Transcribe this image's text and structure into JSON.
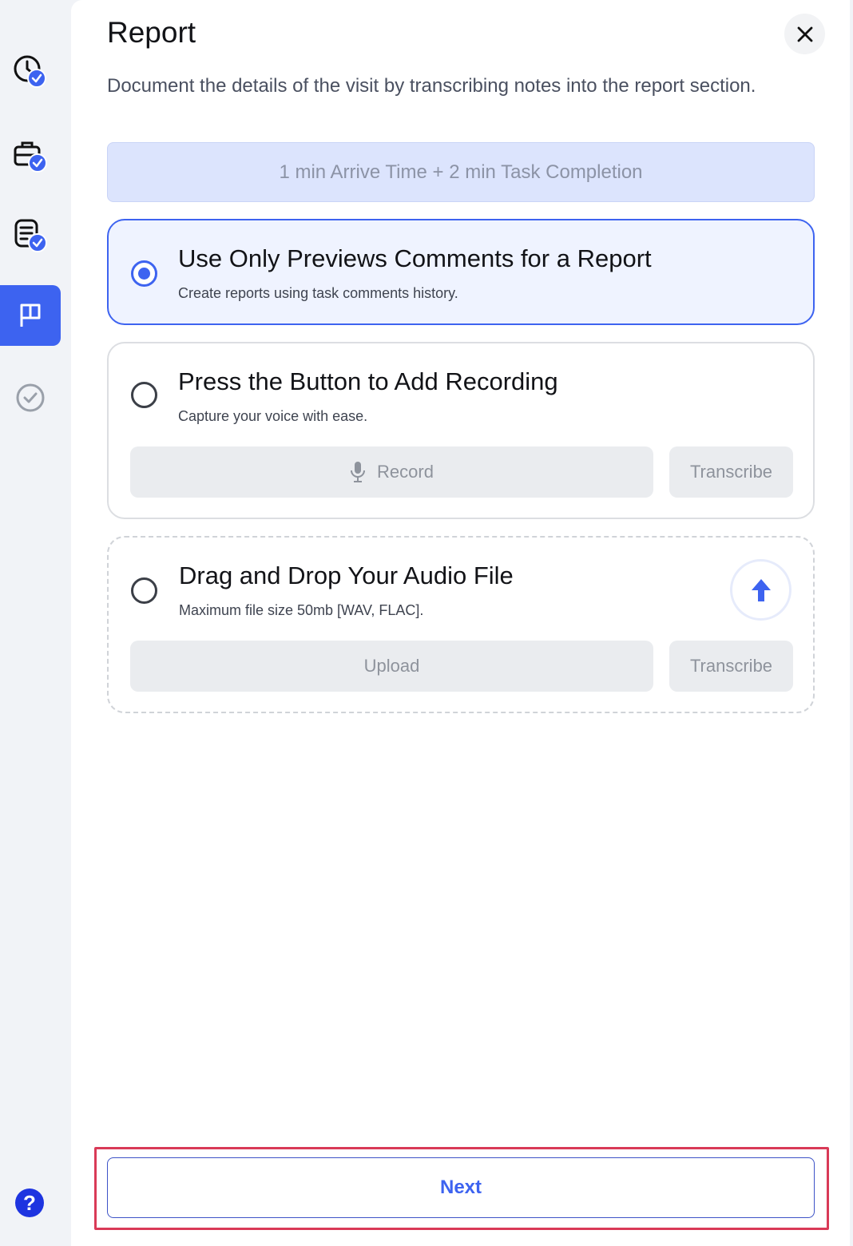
{
  "sidebar": {
    "items": [
      {
        "icon": "clock-check-icon",
        "state": "done"
      },
      {
        "icon": "briefcase-check-icon",
        "state": "done"
      },
      {
        "icon": "document-check-icon",
        "state": "done"
      },
      {
        "icon": "flag-icon",
        "state": "active"
      },
      {
        "icon": "check-circle-icon",
        "state": "pending"
      }
    ],
    "help_label": "?"
  },
  "panel": {
    "title": "Report",
    "description": "Document the details of the visit by transcribing notes into the report section.",
    "time_banner": "1 min Arrive Time + 2 min Task Completion",
    "options": [
      {
        "title": "Use Only Previews Comments for a Report",
        "subtitle": "Create reports using task comments history.",
        "selected": true
      },
      {
        "title": "Press the Button to Add Recording",
        "subtitle": "Capture your voice with ease.",
        "selected": false,
        "record_label": "Record",
        "transcribe_label": "Transcribe"
      },
      {
        "title": "Drag and Drop Your Audio File",
        "subtitle": "Maximum file size 50mb [WAV, FLAC].",
        "selected": false,
        "upload_label": "Upload",
        "transcribe_label": "Transcribe"
      }
    ],
    "next_label": "Next"
  },
  "colors": {
    "accent": "#3d63f0",
    "banner_bg": "#dce4fd",
    "highlight_outline": "#d93a57"
  }
}
